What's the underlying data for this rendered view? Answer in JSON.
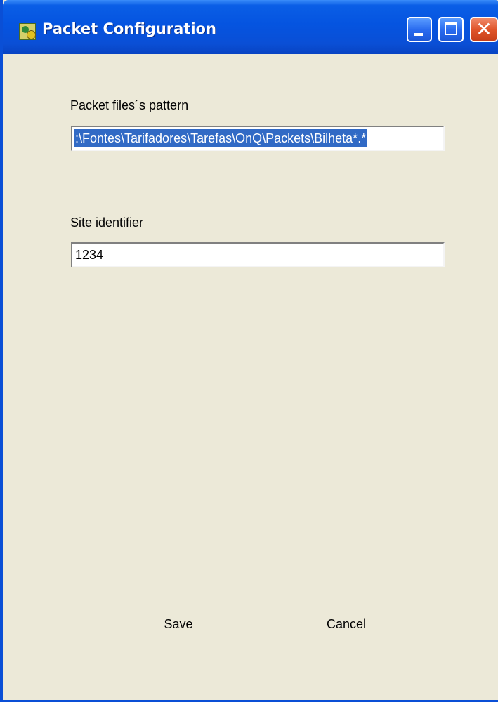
{
  "window": {
    "title": "Packet Configuration",
    "app_icon": "app-icon",
    "controls": {
      "minimize_icon": "minimize-icon",
      "maximize_icon": "maximize-icon",
      "close_icon": "close-icon",
      "close_glyph": "✕"
    }
  },
  "form": {
    "pattern_label": "Packet files´s pattern",
    "pattern_value": ":\\Fontes\\Tarifadores\\Tarefas\\OnQ\\Packets\\Bilheta*.*",
    "site_label": "Site identifier",
    "site_value": "1234"
  },
  "buttons": {
    "save_label": "Save",
    "cancel_label": "Cancel"
  },
  "colors": {
    "titlebar": "#0a4fd6",
    "dialog_bg": "#ece9d8",
    "selection": "#316ac5"
  }
}
